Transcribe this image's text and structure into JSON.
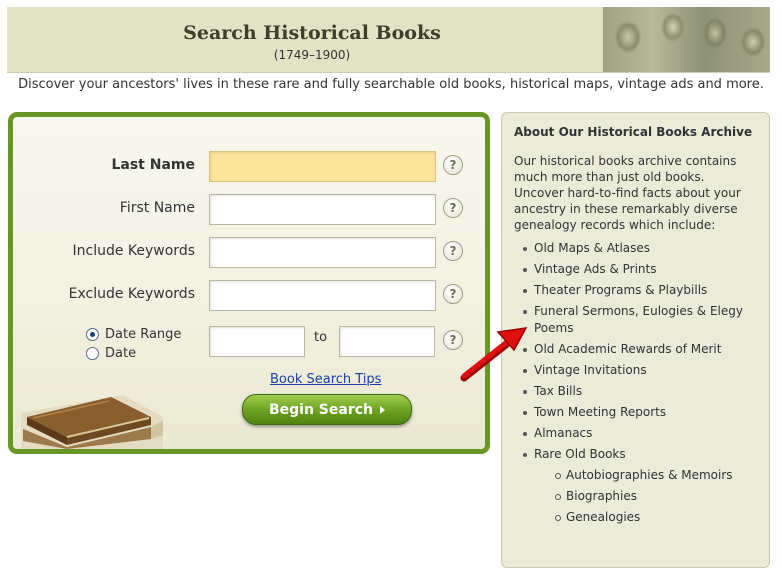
{
  "header": {
    "title": "Search Historical Books",
    "subtitle": "(1749–1900)"
  },
  "tagline": "Discover your ancestors' lives in these rare and fully searchable old books, historical maps, vintage ads and more.",
  "search": {
    "fields": [
      {
        "label": "Last Name",
        "value": ""
      },
      {
        "label": "First Name",
        "value": ""
      },
      {
        "label": "Include Keywords",
        "value": ""
      },
      {
        "label": "Exclude Keywords",
        "value": ""
      }
    ],
    "help_glyph": "?",
    "date_options": [
      {
        "label": "Date Range",
        "checked": true
      },
      {
        "label": "Date",
        "checked": false
      }
    ],
    "date_from": "",
    "date_to": "",
    "date_separator": "to",
    "tips_link": "Book Search Tips",
    "submit_label": "Begin Search"
  },
  "archive": {
    "title": "About Our Historical Books Archive",
    "intro": "Our historical books archive contains much more than just old books. Uncover hard-to-find facts about your ancestry in these remarkably diverse genealogy records which include:",
    "items": [
      "Old Maps & Atlases",
      "Vintage Ads & Prints",
      "Theater Programs & Playbills",
      "Funeral Sermons, Eulogies & Elegy Poems",
      "Old Academic Rewards of Merit",
      "Vintage Invitations",
      "Tax Bills",
      "Town Meeting Reports",
      "Almanacs",
      "Rare Old Books"
    ],
    "sub_items": [
      "Autobiographies & Memoirs",
      "Biographies",
      "Genealogies"
    ]
  },
  "colors": {
    "panel_border": "#6a9625",
    "active_field": "#fce49b",
    "link": "#1a3fa6",
    "annotation_arrow": "#e01010"
  }
}
